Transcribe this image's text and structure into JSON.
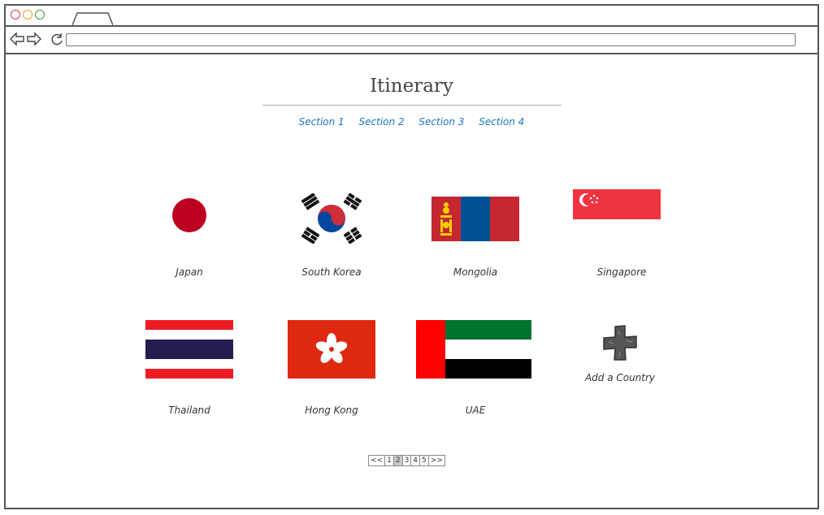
{
  "page": {
    "title": "Itinerary"
  },
  "sections": [
    "Section 1",
    "Section 2",
    "Section 3",
    "Section 4"
  ],
  "countries": [
    {
      "name": "Japan",
      "flag": "japan-flag"
    },
    {
      "name": "South Korea",
      "flag": "south-korea-flag"
    },
    {
      "name": "Mongolia",
      "flag": "mongolia-flag"
    },
    {
      "name": "Singapore",
      "flag": "singapore-flag"
    },
    {
      "name": "Thailand",
      "flag": "thailand-flag"
    },
    {
      "name": "Hong Kong",
      "flag": "hong-kong-flag"
    },
    {
      "name": "UAE",
      "flag": "uae-flag"
    }
  ],
  "add_country": {
    "label": "Add a Country",
    "icon": "plus-icon"
  },
  "pagination": {
    "prev": "<<",
    "pages": [
      "1",
      "2",
      "3",
      "4",
      "5"
    ],
    "next": ">>",
    "current": "2"
  },
  "colors": {
    "link": "#1a73c7",
    "frame": "#555555"
  }
}
